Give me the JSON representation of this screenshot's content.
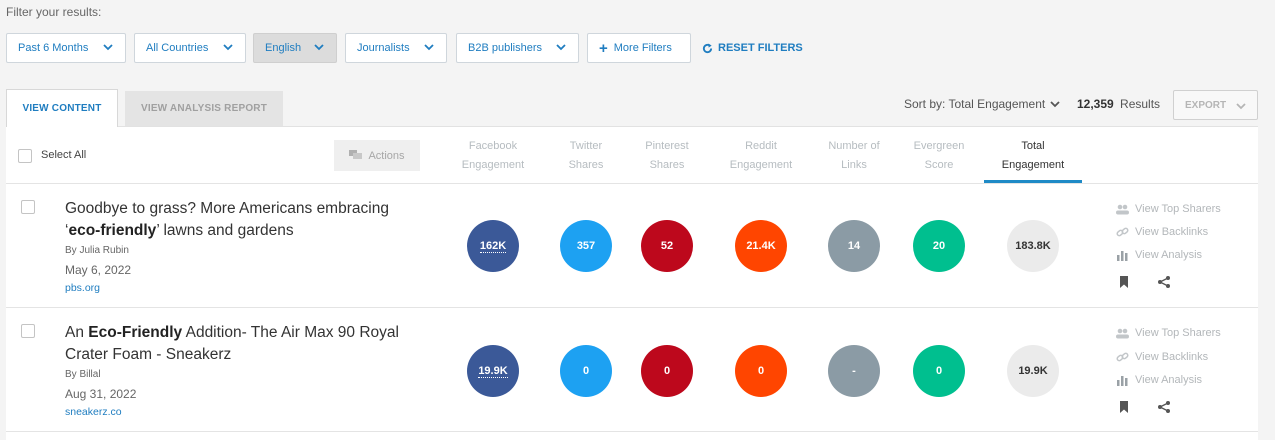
{
  "filter_caption": "Filter your results:",
  "filters": {
    "date": "Past 6 Months",
    "country": "All Countries",
    "language": "English",
    "journalists": "Journalists",
    "publishers": "B2B publishers",
    "more": "More Filters",
    "reset": "RESET FILTERS"
  },
  "tabs": {
    "view_content": "VIEW CONTENT",
    "view_analysis": "VIEW ANALYSIS REPORT"
  },
  "toolbar": {
    "sort_by": "Sort by: Total Engagement",
    "results_count": "12,359",
    "results_label": "Results",
    "export": "EXPORT"
  },
  "table": {
    "select_all": "Select All",
    "actions": "Actions",
    "columns": [
      {
        "line1": "Facebook",
        "line2": "Engagement"
      },
      {
        "line1": "Twitter",
        "line2": "Shares"
      },
      {
        "line1": "Pinterest",
        "line2": "Shares"
      },
      {
        "line1": "Reddit",
        "line2": "Engagement"
      },
      {
        "line1": "Number of",
        "line2": "Links"
      },
      {
        "line1": "Evergreen",
        "line2": "Score"
      },
      {
        "line1": "Total",
        "line2": "Engagement"
      }
    ]
  },
  "rows": [
    {
      "title_a": "Goodbye to grass? More Americans embracing",
      "title_q1": "‘",
      "title_bold": "eco-friendly",
      "title_q2": "’ lawns and gardens",
      "byline": "By  Julia Rubin",
      "date": "May 6, 2022",
      "domain": "pbs.org",
      "metrics": {
        "facebook": "162K",
        "twitter": "357",
        "pinterest": "52",
        "reddit": "21.4K",
        "links": "14",
        "evergreen": "20",
        "total": "183.8K"
      }
    },
    {
      "title_a": "An ",
      "title_bold": "Eco-Friendly",
      "title_b": " Addition- The Air Max 90 Royal Crater Foam  - Sneakerz",
      "byline": "By  Billal",
      "date": "Aug 31, 2022",
      "domain": "sneakerz.co",
      "metrics": {
        "facebook": "19.9K",
        "twitter": "0",
        "pinterest": "0",
        "reddit": "0",
        "links": "-",
        "evergreen": "0",
        "total": "19.9K"
      }
    }
  ],
  "side_links": {
    "top_sharers": "View Top Sharers",
    "backlinks": "View Backlinks",
    "analysis": "View Analysis"
  },
  "colors": {
    "accent": "#1f7dc0",
    "facebook": "#3b5998",
    "twitter": "#1da1f2",
    "pinterest": "#bd081c",
    "reddit": "#ff4500",
    "links": "#8b9ba5",
    "evergreen": "#00bf8f",
    "total": "#ebebeb"
  }
}
